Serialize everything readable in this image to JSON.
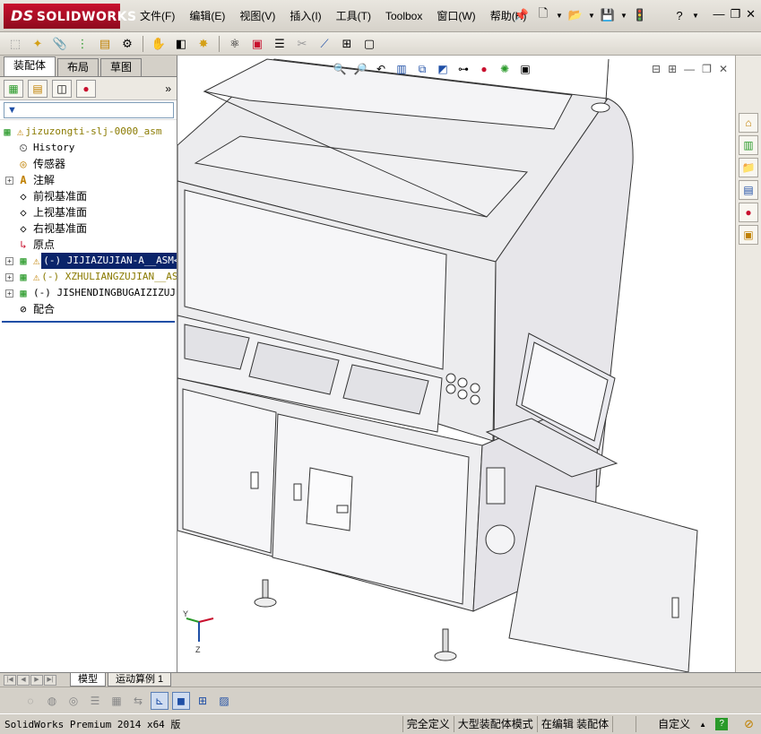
{
  "app": {
    "logo_prefix": "DS",
    "logo_text": "SOLIDWORKS"
  },
  "menu": [
    "文件(F)",
    "编辑(E)",
    "视图(V)",
    "插入(I)",
    "工具(T)",
    "Toolbox",
    "窗口(W)",
    "帮助(H)"
  ],
  "title_tools": {
    "pin_icon": "pin-icon",
    "help_label": "?"
  },
  "cm_tabs": [
    "装配体",
    "布局",
    "草图"
  ],
  "manager_more": "»",
  "tree": {
    "root": "jizuzongti-slj-0000_asm",
    "items": [
      {
        "label": "History",
        "icon": "history-icon"
      },
      {
        "label": "传感器",
        "icon": "sensor-icon"
      },
      {
        "label": "注解",
        "icon": "annotation-icon"
      },
      {
        "label": "前视基准面",
        "icon": "plane-icon"
      },
      {
        "label": "上视基准面",
        "icon": "plane-icon"
      },
      {
        "label": "右视基准面",
        "icon": "plane-icon"
      },
      {
        "label": "原点",
        "icon": "origin-icon"
      }
    ],
    "components": [
      {
        "label": "(-) JIJIAZUJIAN-A__ASM<"
      },
      {
        "label": "(-) XZHULIANGZUJIAN__ASM"
      },
      {
        "label": "(-) JISHENDINGBUGAIZIZUJIAN"
      }
    ],
    "mates": "配合"
  },
  "bottom_tabs": [
    "模型",
    "运动算例 1"
  ],
  "status": {
    "app_version": "SolidWorks Premium 2014 x64 版",
    "definition": "完全定义",
    "mode": "大型装配体模式",
    "editing": "在编辑 装配体",
    "units": "自定义",
    "help": "?"
  },
  "colors": {
    "brand": "#c8102e",
    "selection": "#0a246a",
    "warning": "#c08000"
  }
}
